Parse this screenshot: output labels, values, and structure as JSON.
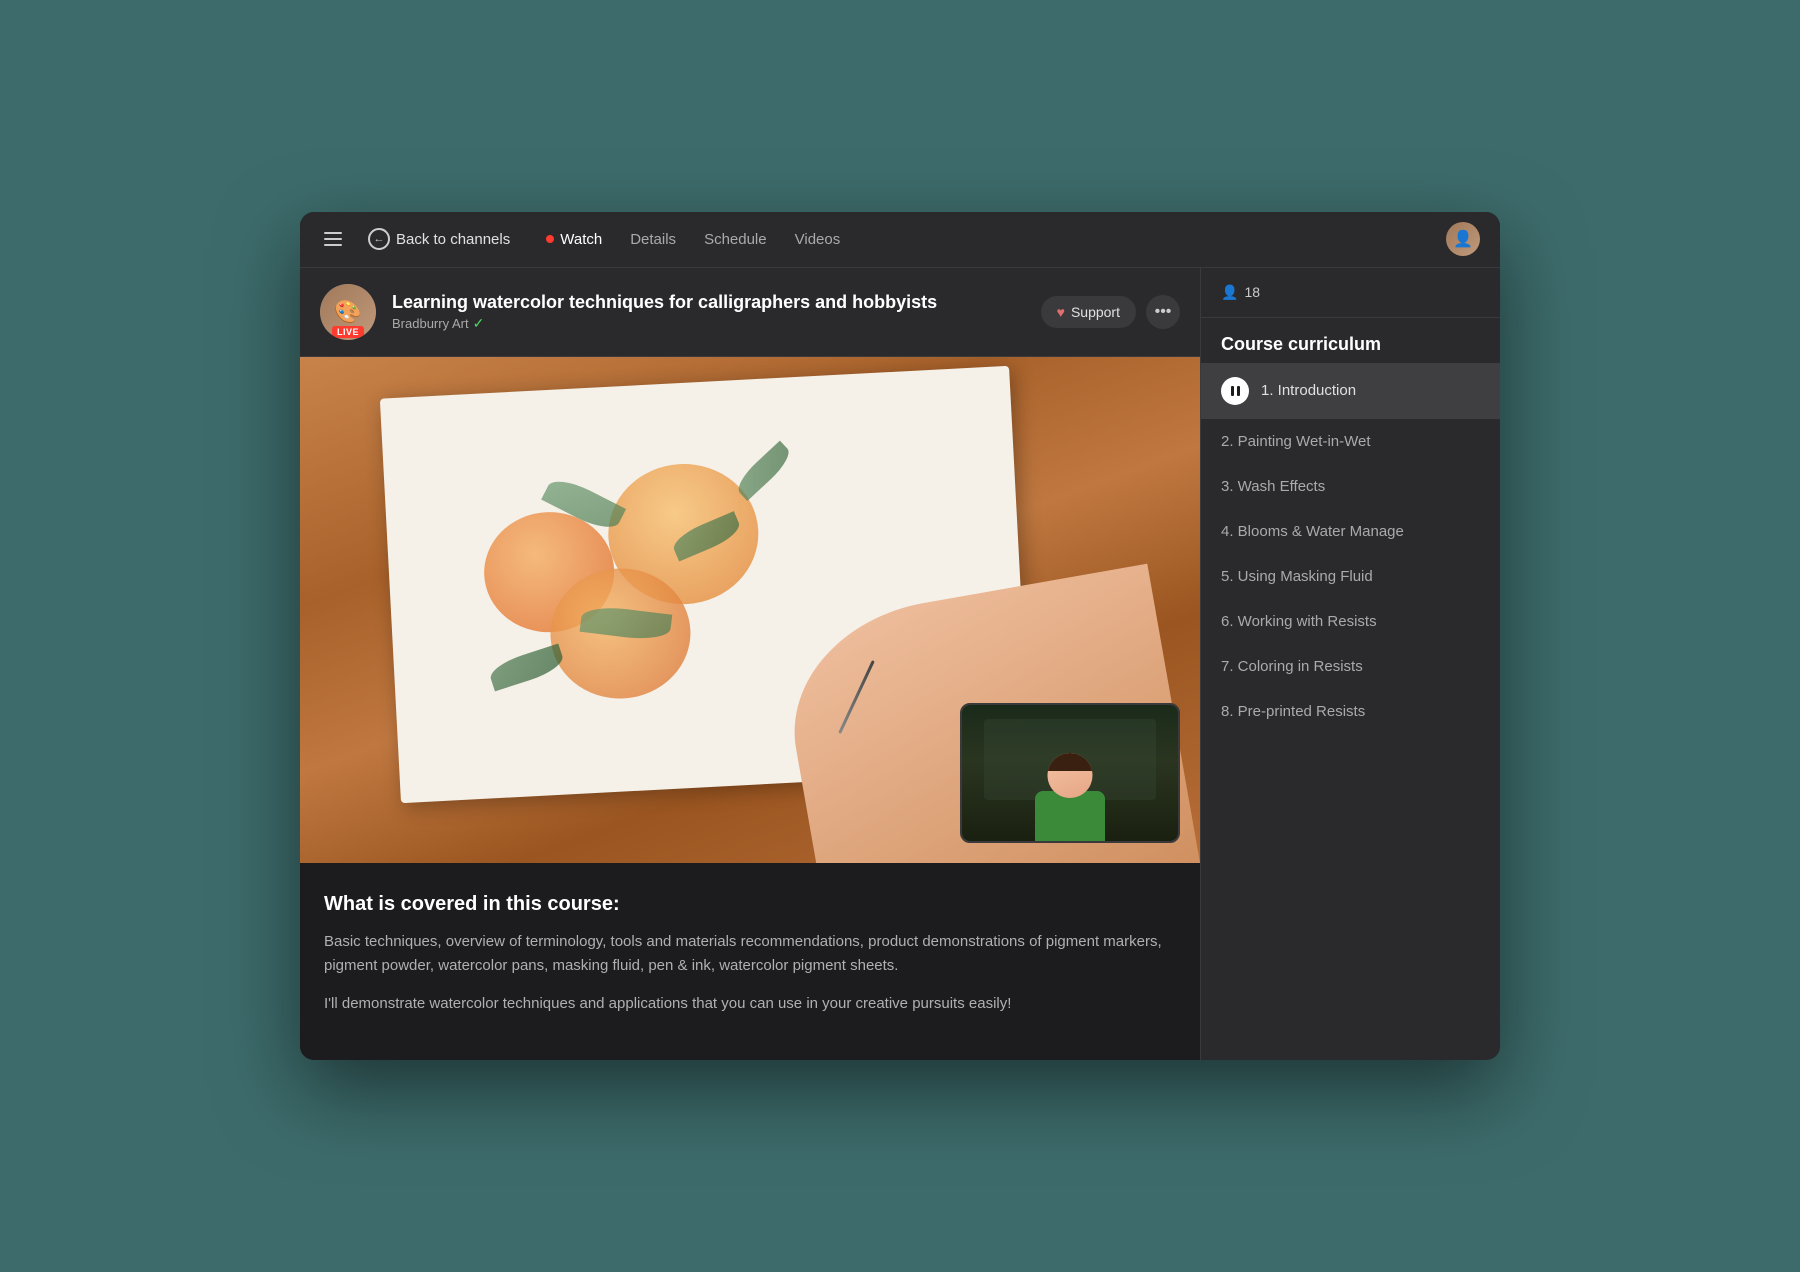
{
  "window": {
    "background_color": "#3d6b6b"
  },
  "nav": {
    "back_label": "Back to channels",
    "watch_label": "Watch",
    "details_label": "Details",
    "schedule_label": "Schedule",
    "videos_label": "Videos",
    "viewers_count": "18"
  },
  "channel": {
    "title": "Learning watercolor techniques for calligraphers and hobbyists",
    "author": "Bradburry Art",
    "live_badge": "LIVE",
    "support_label": "Support"
  },
  "sidebar": {
    "title": "Course curriculum",
    "items": [
      {
        "id": 1,
        "label": "1. Introduction",
        "active": true
      },
      {
        "id": 2,
        "label": "2. Painting Wet-in-Wet",
        "active": false
      },
      {
        "id": 3,
        "label": "3. Wash Effects",
        "active": false
      },
      {
        "id": 4,
        "label": "4. Blooms & Water Manage",
        "active": false
      },
      {
        "id": 5,
        "label": "5. Using Masking Fluid",
        "active": false
      },
      {
        "id": 6,
        "label": "6. Working with Resists",
        "active": false
      },
      {
        "id": 7,
        "label": "7. Coloring in Resists",
        "active": false
      },
      {
        "id": 8,
        "label": "8. Pre-printed Resists",
        "active": false
      }
    ]
  },
  "description": {
    "section_title": "What is covered in this course:",
    "text1": "Basic techniques, overview of terminology, tools and materials recommendations,  product demonstrations of pigment markers, pigment powder, watercolor pans, masking fluid, pen & ink, watercolor pigment sheets.",
    "text2": "I'll demonstrate watercolor techniques and applications that you can use in your creative pursuits easily!"
  }
}
